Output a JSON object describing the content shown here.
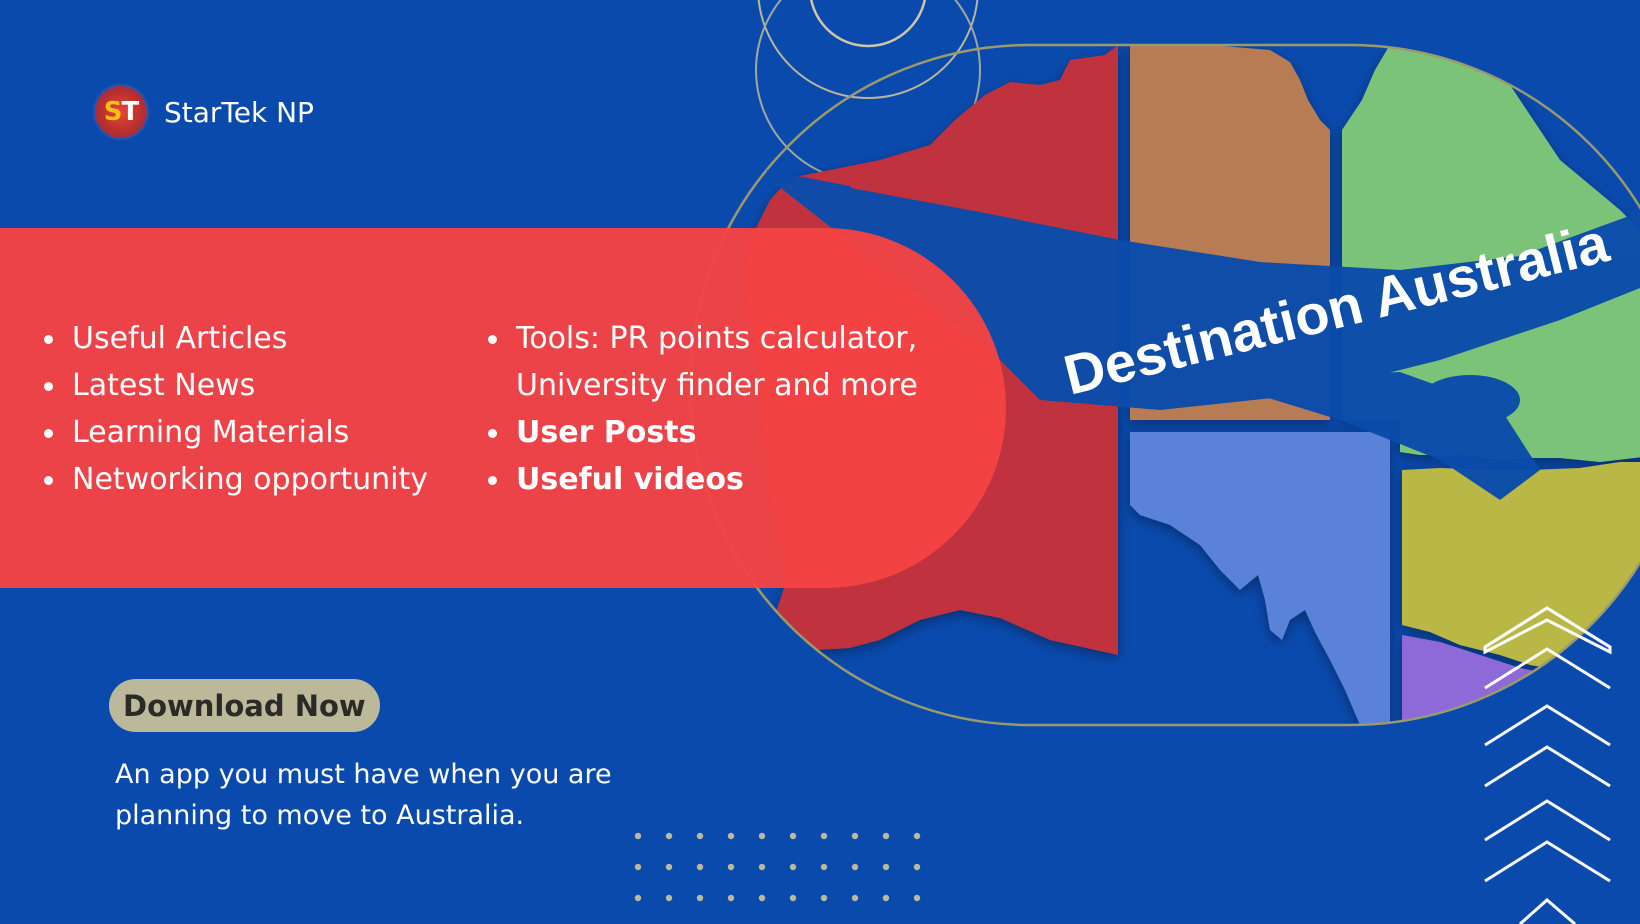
{
  "brand": {
    "logo_letters": "ST",
    "name": "StarTek NP"
  },
  "hero": {
    "headline": "Destination Australia"
  },
  "features": {
    "left": [
      "Useful Articles",
      "Latest News",
      "Learning Materials",
      "Networking opportunity"
    ],
    "right": [
      {
        "text": "Tools: PR points calculator, University finder and more",
        "bold": false
      },
      {
        "text": "User Posts",
        "bold": true
      },
      {
        "text": "Useful videos",
        "bold": true
      }
    ]
  },
  "cta": {
    "download_label": "Download Now",
    "tagline": "An app you must have when you are planning to move to Australia."
  },
  "colors": {
    "background": "#0a4aad",
    "banner": "#f44344",
    "button": "#bcb89a",
    "wa": "#c0313c",
    "nt": "#b87c55",
    "qld": "#7cc37a",
    "sa": "#5a82d8",
    "nsw": "#b9b847",
    "vic": "#8e6bd8"
  },
  "icons": {
    "chevrons": "chevron-up-icon",
    "plane": "airplane-silhouette"
  }
}
